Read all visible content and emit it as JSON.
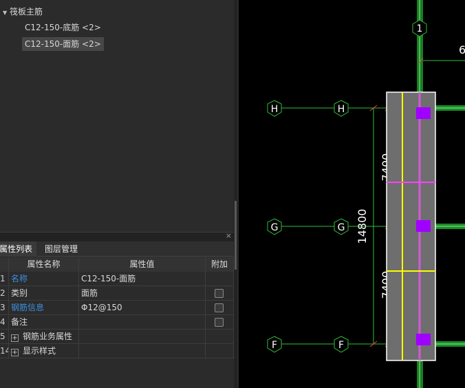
{
  "tree": {
    "root_label": "筏板主筋",
    "items": [
      {
        "label": "C12-150-底筋 <2>",
        "selected": false
      },
      {
        "label": "C12-150-面筋 <2>",
        "selected": true
      }
    ]
  },
  "props_panel": {
    "close_glyph": "×",
    "tabs": [
      {
        "label": "属性列表",
        "active": true
      },
      {
        "label": "图层管理",
        "active": false
      }
    ],
    "table": {
      "headers": {
        "name": "属性名称",
        "value": "属性值",
        "extra": "附加"
      },
      "rows": [
        {
          "num": "1",
          "name": "名称",
          "value": "C12-150-面筋"
        },
        {
          "num": "2",
          "name": "类别",
          "value": "面筋"
        },
        {
          "num": "3",
          "name": "钢筋信息",
          "value": "Φ12@150"
        },
        {
          "num": "4",
          "name": "备注",
          "value": ""
        },
        {
          "num": "5",
          "name": "钢筋业务属性",
          "value": ""
        },
        {
          "num": "14",
          "name": "显示样式",
          "value": ""
        }
      ]
    }
  },
  "drawing": {
    "axis_top": "1",
    "axis_rows": [
      "H",
      "G",
      "F"
    ],
    "dim_total": "14800",
    "dim_upper": "7400",
    "dim_lower": "7400",
    "dim_partial_top": "6",
    "colors": {
      "background": "#000000",
      "axis_line": "#2fbf3a",
      "slab": "#6e6e6e",
      "slab_edge": "#ffffff",
      "yellow_rebar": "#ffff00",
      "magenta_rebar": "#ff40ff",
      "column": "#a000ff",
      "dimension": "#ffffff"
    }
  }
}
